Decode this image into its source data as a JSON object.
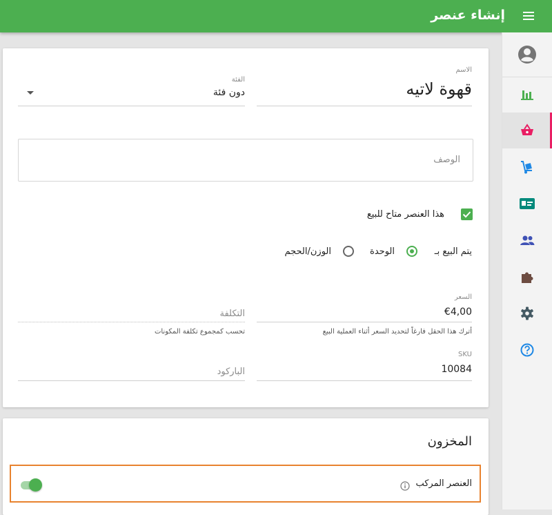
{
  "header": {
    "title": "إنشاء عنصر",
    "menu_icon": "hamburger-menu-icon"
  },
  "sidebar": {
    "account_icon": "account-circle-icon",
    "items": [
      {
        "icon": "bar-chart-icon",
        "color": "#4caf50"
      },
      {
        "icon": "shopping-basket-icon",
        "color": "#e91e63",
        "active": true
      },
      {
        "icon": "dolly-cart-icon",
        "color": "#1e88e5"
      },
      {
        "icon": "id-card-icon",
        "color": "#00897b"
      },
      {
        "icon": "people-icon",
        "color": "#3f51b5"
      },
      {
        "icon": "puzzle-piece-icon",
        "color": "#6d4c41"
      },
      {
        "icon": "gear-icon",
        "color": "#455a64"
      },
      {
        "icon": "help-circle-icon",
        "color": "#1e88e5"
      }
    ]
  },
  "form": {
    "name": {
      "label": "الاسم",
      "value": "قهوة لاتيه"
    },
    "category": {
      "label": "الفئة",
      "value": "دون فئة"
    },
    "description": {
      "placeholder": "الوصف"
    },
    "available": {
      "label": "هذا العنصر متاح للبيع",
      "checked": true
    },
    "sold_by": {
      "label": "يتم البيع بـ",
      "options": [
        {
          "label": "الوحدة",
          "selected": true
        },
        {
          "label": "الوزن/الحجم",
          "selected": false
        }
      ]
    },
    "price": {
      "label": "السعر",
      "value": "€4,00",
      "hint": "أترك هذا الحقل فارغاً لتحديد السعر أثناء العملية البيع"
    },
    "cost": {
      "placeholder": "التكلفة",
      "hint": "تحسب كمجموع تكلفة المكونات"
    },
    "sku": {
      "label": "SKU",
      "value": "10084"
    },
    "barcode": {
      "placeholder": "الباركود"
    }
  },
  "inventory": {
    "title": "المخزون",
    "composite": {
      "label": "العنصر المركب",
      "info_icon": "info-icon",
      "enabled": true
    }
  }
}
